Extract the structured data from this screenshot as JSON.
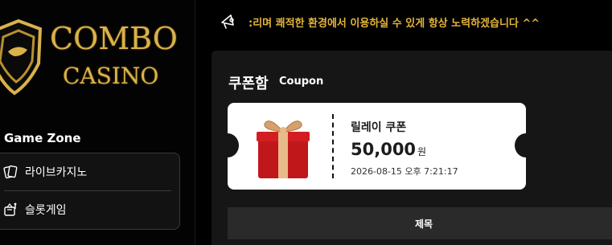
{
  "brand": {
    "line1": "COMBO",
    "line2": "CASINO"
  },
  "sidebar": {
    "zone_title": "Game Zone",
    "items": [
      {
        "label": "라이브카지노",
        "icon": "cards-icon"
      },
      {
        "label": "슬롯게임",
        "icon": "slot-machine-icon"
      }
    ]
  },
  "ticker": {
    "text": ":리며 쾌적한 환경에서 이용하실 수 있게 항상 노력하겠습니다 ^^",
    "icon": "megaphone-icon"
  },
  "coupon_box": {
    "title": "쿠폰함",
    "subtitle": "Coupon",
    "coupon": {
      "name": "릴레이 쿠폰",
      "amount": "50,000",
      "unit": "원",
      "date": "2026-08-15 오후 7:21:17"
    },
    "table_header": "제목"
  },
  "colors": {
    "accent_gold": "#e3b43b",
    "panel": "#161616"
  }
}
